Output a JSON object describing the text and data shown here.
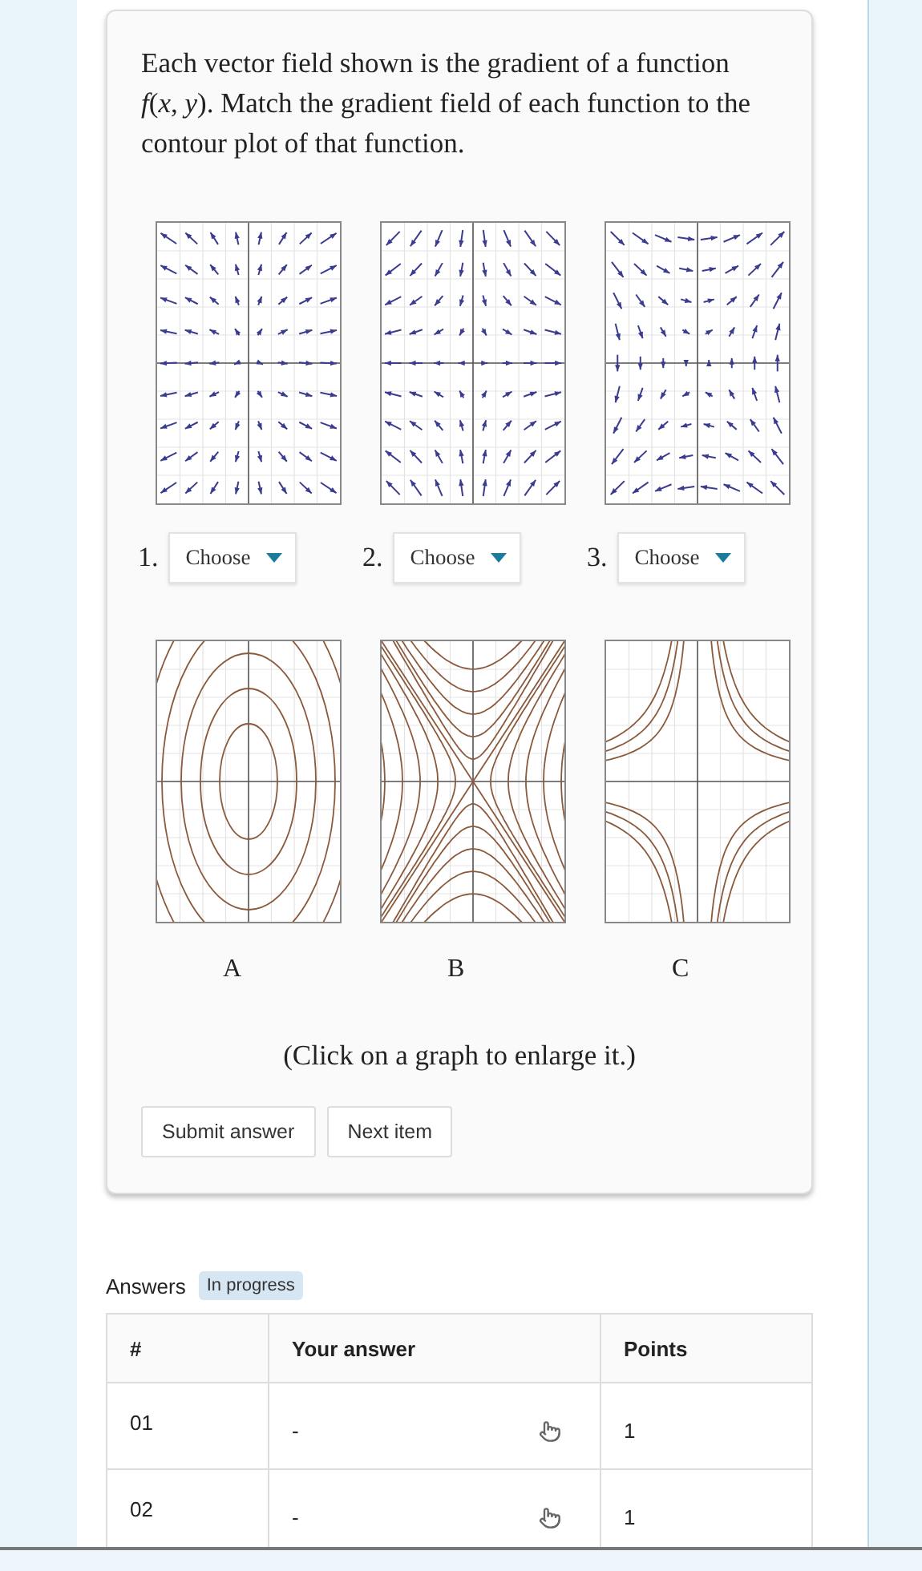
{
  "question": {
    "text": "Each vector field shown is the gradient of a function *f*(*x*, *y*). Match the gradient field of each function to the contour plot of that function.",
    "vector_fields": [
      {
        "number": "1.",
        "select": "Choose",
        "kind": "spread"
      },
      {
        "number": "2.",
        "select": "Choose",
        "kind": "saddle"
      },
      {
        "number": "3.",
        "select": "Choose",
        "kind": "product"
      }
    ],
    "contour_plots": [
      {
        "label": "A",
        "kind": "ellipse"
      },
      {
        "label": "B",
        "kind": "saddle"
      },
      {
        "label": "C",
        "kind": "product"
      }
    ],
    "hint": "(Click on a graph to enlarge it.)",
    "buttons": [
      "Submit answer",
      "Next item"
    ]
  },
  "answers": {
    "title": "Answers",
    "status": "In progress",
    "columns": [
      "#",
      "Your answer",
      "Points"
    ],
    "rows": [
      {
        "number": "01",
        "answer": "-",
        "points": "1"
      },
      {
        "number": "02",
        "answer": "-",
        "points": "1"
      }
    ]
  }
}
